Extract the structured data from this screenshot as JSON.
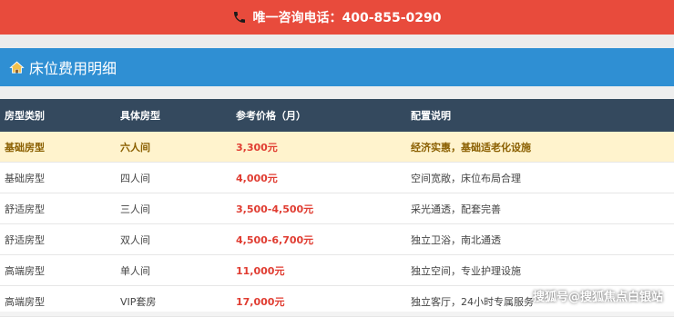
{
  "topbar": {
    "text": "唯一咨询电话：400-855-0290",
    "bg": "#e84b3c"
  },
  "section": {
    "title": "床位费用明细",
    "bg": "#2f8fd3"
  },
  "table": {
    "headers": [
      "房型类别",
      "具体房型",
      "参考价格（月）",
      "配置说明"
    ],
    "rows": [
      {
        "category": "基础房型",
        "room": "六人间",
        "price": "3,300元",
        "desc": "经济实惠，基础适老化设施"
      },
      {
        "category": "基础房型",
        "room": "四人间",
        "price": "4,000元",
        "desc": "空间宽敞，床位布局合理"
      },
      {
        "category": "舒适房型",
        "room": "三人间",
        "price": "3,500-4,500元",
        "desc": "采光通透，配套完善"
      },
      {
        "category": "舒适房型",
        "room": "双人间",
        "price": "4,500-6,700元",
        "desc": "独立卫浴，南北通透"
      },
      {
        "category": "高端房型",
        "room": "单人间",
        "price": "11,000元",
        "desc": "独立空间，专业护理设施"
      },
      {
        "category": "高端房型",
        "room": "VIP套房",
        "price": "17,000元",
        "desc": "独立客厅，24小时专属服务"
      }
    ]
  },
  "watermark": "搜狐号@搜狐焦点白银站"
}
